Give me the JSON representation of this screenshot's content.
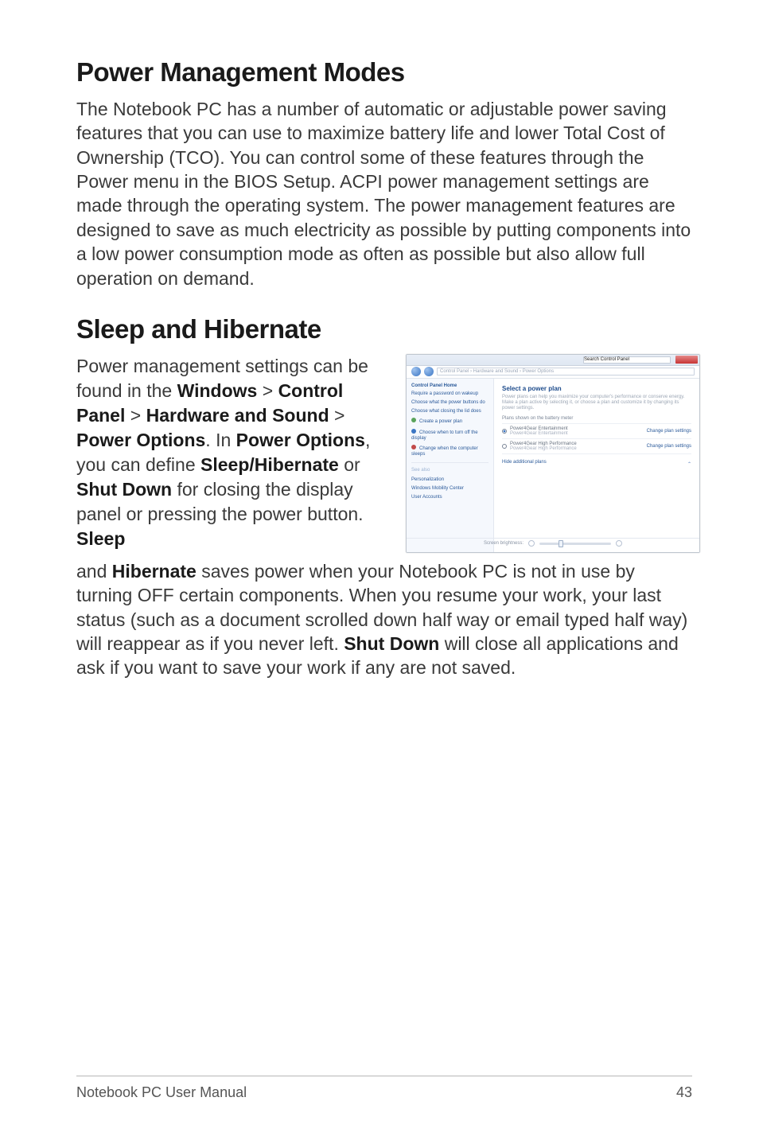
{
  "headings": {
    "h1": "Power Management Modes",
    "h2": "Sleep and Hibernate"
  },
  "para1": "The Notebook PC has a number of automatic or adjustable power saving features that you can use to maximize battery life and lower Total Cost of Ownership (TCO). You can control some of these features through the Power menu in the BIOS Setup. ACPI power management settings are made through the operating system. The power management features are designed to save as much electricity as possible by putting components into a low power consumption mode as often as possible but also allow full operation on demand.",
  "sleep_left": {
    "pre": "Power management settings can be found in the ",
    "b1": "Windows",
    "gt1": " > ",
    "b2": "Control Panel",
    "gt2": " > ",
    "b3": "Hardware and Sound",
    "gt3": " > ",
    "b4": "Power Options",
    "post1": ". In ",
    "b5": "Power Options",
    "post2": ", you can define ",
    "b6": "Sleep/Hibernate",
    "or": " or ",
    "b7": "Shut Down",
    "post3": " for closing the display panel or pressing the power button. ",
    "b8": "Sleep"
  },
  "para3": {
    "pre": "and ",
    "b1": "Hibernate",
    "mid1": " saves power when your Notebook PC is not in use by turning OFF certain components. When you resume your work, your last status (such as a document scrolled down half way or email typed half way) will reappear as if you never left. ",
    "b2": "Shut Down",
    "mid2": " will close all applications and ask if you want to save your work if any are not saved."
  },
  "win": {
    "breadcrumb": "Control Panel › Hardware and Sound › Power Options",
    "search_placeholder": "Search Control Panel",
    "side_heading": "Control Panel Home",
    "side_links": [
      "Require a password on wakeup",
      "Choose what the power buttons do",
      "Choose what closing the lid does",
      "Create a power plan",
      "Choose when to turn off the display",
      "Change when the computer sleeps"
    ],
    "see_also": "See also",
    "see_also_links": [
      "Personalization",
      "Windows Mobility Center",
      "User Accounts"
    ],
    "main_heading": "Select a power plan",
    "main_desc": "Power plans can help you maximize your computer's performance or conserve energy. Make a plan active by selecting it, or choose a plan and customize it by changing its power settings.",
    "sub1": "Plans shown on the battery meter",
    "plan1": "Power4Gear Entertainment",
    "plan1_sub": "Power4Gear Entertainment",
    "sub2_hide": "Hide additional plans",
    "plan2": "Power4Gear High Performance",
    "plan2_sub": "Power4Gear High Performance",
    "change": "Change plan settings",
    "brightness": "Screen brightness:"
  },
  "footer": {
    "left": "Notebook PC User Manual",
    "right": "43"
  }
}
